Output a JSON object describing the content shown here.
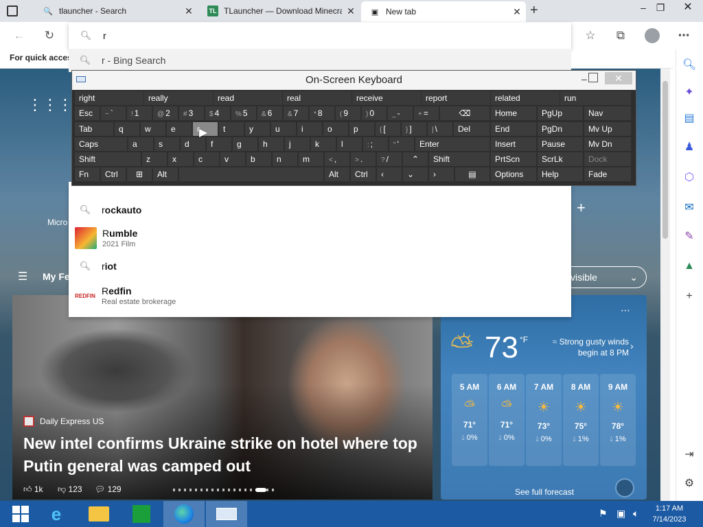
{
  "tabs": [
    {
      "title": "tlauncher - Search",
      "icon": "search-icon"
    },
    {
      "title": "TLauncher — Download Minecraft",
      "icon_text": "TL"
    },
    {
      "title": "New tab",
      "icon": "newtab-icon"
    }
  ],
  "address": {
    "query": "r"
  },
  "favorites_bar": {
    "text": "For quick access"
  },
  "osk": {
    "title": "On-Screen Keyboard",
    "predictions": [
      "right",
      "really",
      "read",
      "real",
      "receive",
      "report",
      "related",
      "run"
    ],
    "row1": {
      "esc": "Esc",
      "keys": [
        [
          "~",
          "`"
        ],
        [
          "!",
          "1"
        ],
        [
          "@",
          "2"
        ],
        [
          "#",
          "3"
        ],
        [
          "$",
          "4"
        ],
        [
          "%",
          "5"
        ],
        [
          "&",
          "6"
        ],
        [
          "&",
          "7"
        ],
        [
          "*",
          "8"
        ],
        [
          "(",
          "9"
        ],
        [
          ")",
          "0"
        ],
        [
          "_",
          "-"
        ],
        [
          "+",
          "="
        ]
      ]
    },
    "row2": {
      "tab": "Tab",
      "keys": [
        "q",
        "w",
        "e",
        "r",
        "t",
        "y",
        "u",
        "i",
        "o",
        "p"
      ],
      "brackets": [
        [
          "{",
          "["
        ],
        [
          "}",
          "]"
        ],
        [
          "|",
          "\\"
        ]
      ],
      "del": "Del"
    },
    "row3": {
      "caps": "Caps",
      "keys": [
        "a",
        "s",
        "d",
        "f",
        "g",
        "h",
        "j",
        "k",
        "l"
      ],
      "punct": [
        [
          ":",
          ";"
        ],
        [
          "\"",
          "'"
        ]
      ],
      "enter": "Enter"
    },
    "row4": {
      "shift": "Shift",
      "keys": [
        "z",
        "x",
        "c",
        "v",
        "b",
        "n",
        "m"
      ],
      "punct": [
        [
          "<",
          ","
        ],
        [
          ">",
          "."
        ],
        [
          "?",
          "/"
        ]
      ],
      "shift2": "Shift"
    },
    "row5": {
      "fn": "Fn",
      "ctrl": "Ctrl",
      "alt": "Alt",
      "alt2": "Alt",
      "ctrl2": "Ctrl"
    },
    "nav": {
      "home": "Home",
      "pgup": "PgUp",
      "navk": "Nav",
      "end": "End",
      "pgdn": "PgDn",
      "mvup": "Mv Up",
      "insert": "Insert",
      "pause": "Pause",
      "mvdn": "Mv Dn",
      "prtscn": "PrtScn",
      "scrlk": "ScrLk",
      "dock": "Dock",
      "options": "Options",
      "help": "Help",
      "fade": "Fade"
    }
  },
  "suggestions": {
    "top": {
      "text": "r - Bing Search"
    },
    "items": [
      {
        "bold_prefix": "r",
        "rest": "ockauto",
        "type": "search"
      },
      {
        "bold_prefix": "R",
        "rest": "umble",
        "subtitle": "2021 Film",
        "type": "movie"
      },
      {
        "bold_prefix": "r",
        "rest": "iot",
        "type": "search"
      },
      {
        "bold_prefix": "R",
        "rest": "edfin",
        "subtitle": "Real estate brokerage",
        "type": "redfin",
        "logo_text": "REDFIN"
      }
    ]
  },
  "page": {
    "my_feed": "My Fe",
    "micro_label": "Micro",
    "visible_btn": "visible"
  },
  "news": {
    "source": "Daily Express US",
    "headline": "New intel confirms Ukraine strike on hotel where top Putin general was camped out",
    "likes": "1k",
    "dislikes": "123",
    "comments": "129"
  },
  "weather": {
    "temp": "73",
    "unit": "°F",
    "alert": "Strong gusty winds begin at 8 PM",
    "hours": [
      {
        "time": "5 AM",
        "temp": "71°",
        "precip": "0%"
      },
      {
        "time": "6 AM",
        "temp": "71°",
        "precip": "0%"
      },
      {
        "time": "7 AM",
        "temp": "73°",
        "precip": "0%"
      },
      {
        "time": "8 AM",
        "temp": "75°",
        "precip": "1%"
      },
      {
        "time": "9 AM",
        "temp": "78°",
        "precip": "1%"
      }
    ],
    "full_forecast": "See full forecast"
  },
  "taskbar": {
    "time": "1:17 AM",
    "date": "7/14/2023"
  },
  "colors": {
    "taskbar": "#1c5aa3",
    "osk_key": "#3c3c3c",
    "weather": "#3d7ab3"
  }
}
